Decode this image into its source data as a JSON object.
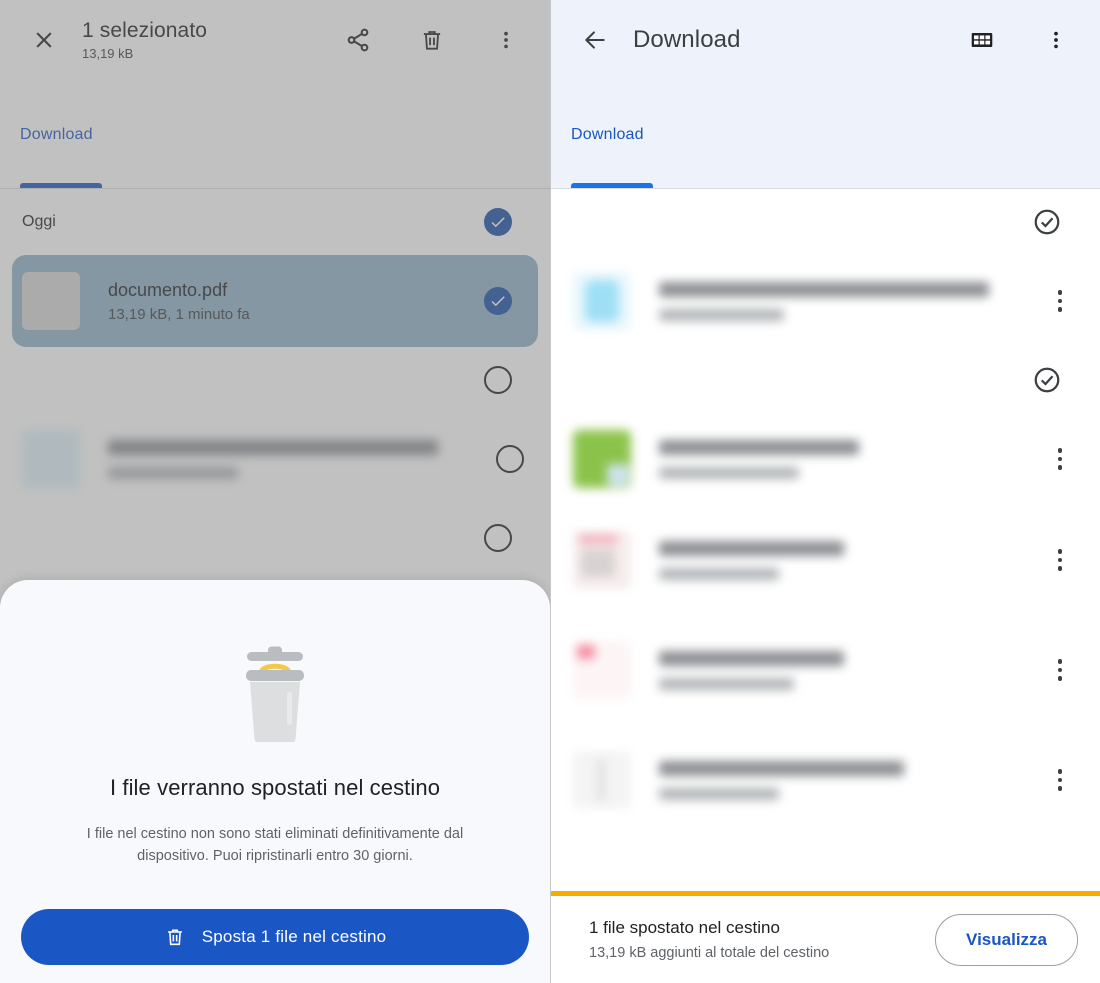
{
  "left_panel": {
    "appbar": {
      "close_icon": "close-icon",
      "title": "1 selezionato",
      "subtitle": "13,19 kB",
      "share_icon": "share-icon",
      "delete_icon": "trash-icon",
      "overflow_icon": "more-vert-icon"
    },
    "tabs": [
      {
        "label": "Download",
        "selected": true
      }
    ],
    "section": {
      "label": "Oggi",
      "checkbox_state": "checked"
    },
    "files": [
      {
        "name": "documento.pdf",
        "subtitle": "13,19 kB, 1 minuto fa",
        "selected": true,
        "checkbox_state": "checked"
      },
      {
        "name": "",
        "subtitle": "",
        "selected": false,
        "checkbox_state": "unchecked",
        "blurred": true
      },
      {
        "name": "",
        "subtitle": "",
        "selected": false,
        "checkbox_state": "unchecked",
        "blurred": true
      }
    ],
    "sheet": {
      "illustration": "trash-bin-illustration",
      "title": "I file verranno spostati nel cestino",
      "body": "I file nel cestino non sono stati eliminati definitivamente dal dispositivo. Puoi ripristinarli entro 30 giorni.",
      "cta_icon": "trash-icon",
      "cta_label": "Sposta 1 file nel cestino"
    }
  },
  "right_panel": {
    "appbar": {
      "back_icon": "arrow-back-icon",
      "title": "Download",
      "grid_icon": "grid-view-icon",
      "overflow_icon": "more-vert-icon"
    },
    "tabs": [
      {
        "label": "Download",
        "selected": true
      }
    ],
    "groups": [
      {
        "checkbox_state": "checked-outline"
      },
      {
        "checkbox_state": "checked-outline"
      }
    ],
    "files": [
      {
        "name": "",
        "subtitle": "",
        "blurred": true,
        "thumb_color": "#bfe7f5",
        "overflow_icon": "more-vert-icon"
      },
      {
        "name": "",
        "subtitle": "",
        "blurred": true,
        "thumb_color": "#8bc34a",
        "overflow_icon": "more-vert-icon"
      },
      {
        "name": "",
        "subtitle": "",
        "blurred": true,
        "thumb_color": "#f1d7d7",
        "overflow_icon": "more-vert-icon"
      },
      {
        "name": "",
        "subtitle": "",
        "blurred": true,
        "thumb_color": "#fadadd",
        "overflow_icon": "more-vert-icon"
      },
      {
        "name": "",
        "subtitle": "",
        "blurred": true,
        "thumb_color": "#eeeeee",
        "overflow_icon": "more-vert-icon"
      }
    ],
    "snackbar": {
      "accent_color": "#f9ab00",
      "title": "1 file spostato nel cestino",
      "subtitle": "13,19 kB aggiunti al totale del cestino",
      "action_label": "Visualizza"
    }
  },
  "colors": {
    "accent_blue": "#1a56c4",
    "selected_row": "#90b2c6",
    "snackbar_accent": "#f9ab00",
    "scrim": "rgba(120,120,120,0.46)"
  }
}
